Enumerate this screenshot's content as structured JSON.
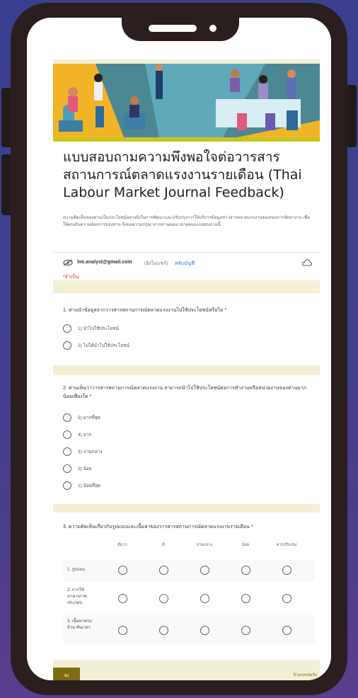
{
  "form": {
    "title_line1": "แบบสอบถามความพึงพอใจต่อวารสาร",
    "title_line2": "สถานการณ์ตลาดแรงงานรายเดือน (Thai",
    "title_line3": "Labour Market Journal Feedback)",
    "description": "ความคิดเห็นของท่านเป็นประโยชน์อย่างยิ่งในการพัฒนาและปรับปรุงการให้บริการข้อมูลข่าวสารตลาดแรงงานของกองการจัดหางาน เพื่อให้ตรงกับความต้องการของท่าน จึงขอความกรุณาจากท่านตอบเวลาตอบแบบสอบถามนี้",
    "account_email": "lmi.analyst@gmail.com",
    "account_status": "(ยังไม่แชร์)",
    "switch_account": "สลับบัญชี",
    "required_note": "*จำเป็น"
  },
  "question1": {
    "text": "1. ท่านนำข้อมูลจากวารสารสถานการณ์ตลาดแรงงานไปใช้ประโยชน์หรือไม่ *",
    "options": [
      "1) นำไปใช้ประโยชน์",
      "2) ไม่ได้นำไปใช้ประโยชน์"
    ]
  },
  "question2": {
    "text": "2. ท่านเห็นว่าวารสารสถานการณ์ตลาดแรงงาน สามารถนำไปใช้ประโยชน์ต่อการทำงานหรือหน่วยงานของท่านมากน้อยเพียงใด *",
    "options": [
      "5) มากที่สุด",
      "4) มาก",
      "3) ปานกลาง",
      "2) น้อย",
      "1) น้อยที่สุด"
    ]
  },
  "question3": {
    "text": "3. ความคิดเห็นเกี่ยวกับรูปแบบและเนื้อหาของวารสารสถานการณ์ตลาดแรงงานรายเดือน *",
    "columns": [
      "ดีมาก",
      "ดี",
      "ปานกลาง",
      "น้อย",
      "ควรปรับปรุง"
    ],
    "rows": [
      "1. รูปแบบ",
      "2. การใช้ภาษา/ภาพประกอบ",
      "3. เนื้อหาครบถ้วน ทันเวลา"
    ]
  },
  "footer": {
    "submit_label": "ส่ง",
    "clear_label": "ล้างแบบฟอร์ม"
  },
  "colors": {
    "background": "#3d3f8c",
    "phone_frame": "#2a1f1e",
    "form_accent": "#c8c418",
    "submit_button": "#7d6d12"
  }
}
